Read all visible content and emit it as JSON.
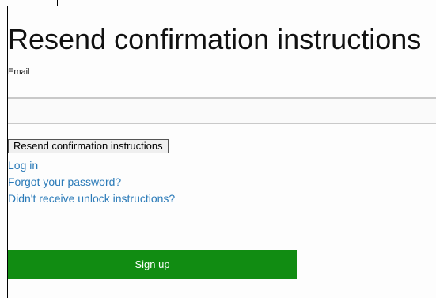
{
  "page": {
    "title": "Resend confirmation instructions"
  },
  "form": {
    "email_label": "Email",
    "email_value": "",
    "email_placeholder": "",
    "submit_label": "Resend confirmation instructions"
  },
  "links": {
    "log_in": "Log in",
    "forgot_password": "Forgot your password?",
    "unlock_instructions": "Didn't receive unlock instructions?"
  },
  "signup": {
    "label": "Sign up",
    "color": "#118c12"
  },
  "theme": {
    "link_color": "#2a7ab8"
  }
}
